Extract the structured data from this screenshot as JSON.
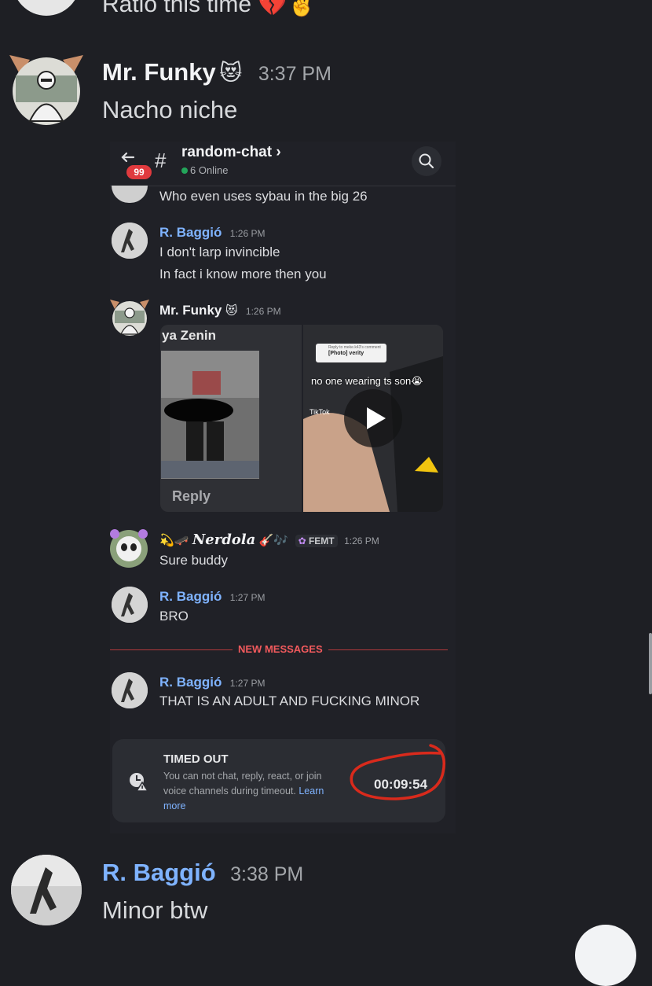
{
  "top_message": {
    "text": "Ratio this time",
    "emoji": "💔✌️"
  },
  "message_funky": {
    "author": "Mr. Funky",
    "emoji": "😻",
    "time": "3:37 PM",
    "body": "Nacho niche"
  },
  "embedded": {
    "header": {
      "back_badge": "99",
      "channel_icon": "#",
      "channel": "random-chat",
      "chevron": "›",
      "online": "6 Online"
    },
    "partial_message": "Who even uses sybau in the big 26",
    "messages": [
      {
        "author": "R. Baggió",
        "time": "1:26 PM",
        "lines": [
          "I don't larp invincible",
          "In fact i know more then you"
        ]
      },
      {
        "author": "Mr. Funky",
        "emoji": "😻",
        "time": "1:26 PM",
        "partial_label": "ya Zenin",
        "reply_label": "Reply",
        "video": {
          "reply_header": "Reply to meke.k43's comment",
          "photo_chip": "[Photo] verity",
          "caption": "no one wearing ts son😭",
          "tiktok": "TikTok"
        }
      },
      {
        "author": "Nerdola",
        "prefix_emoji": "💫🛹",
        "suffix_emoji": "🎸🎶",
        "tag": "FEMT",
        "time": "1:26 PM",
        "body": "Sure buddy"
      },
      {
        "author": "R. Baggió",
        "time": "1:27 PM",
        "body": "BRO"
      }
    ],
    "divider": "NEW MESSAGES",
    "after_divider": {
      "author": "R. Baggió",
      "time": "1:27 PM",
      "body": "THAT IS AN ADULT AND FUCKING MINOR"
    },
    "timeout": {
      "title": "TIMED OUT",
      "text_line1": "You can not chat, reply, react, or join",
      "text_line2": "voice channels during timeout.",
      "learn": "Learn",
      "more": "more",
      "timer": "00:09:54"
    }
  },
  "message_baggio": {
    "author": "R. Baggió",
    "time": "3:38 PM",
    "body": "Minor btw"
  },
  "colors": {
    "background": "#1e1f24",
    "link": "#7fb3ff",
    "divider_red": "#f23f43",
    "annotation_circle": "#d92a1c"
  }
}
